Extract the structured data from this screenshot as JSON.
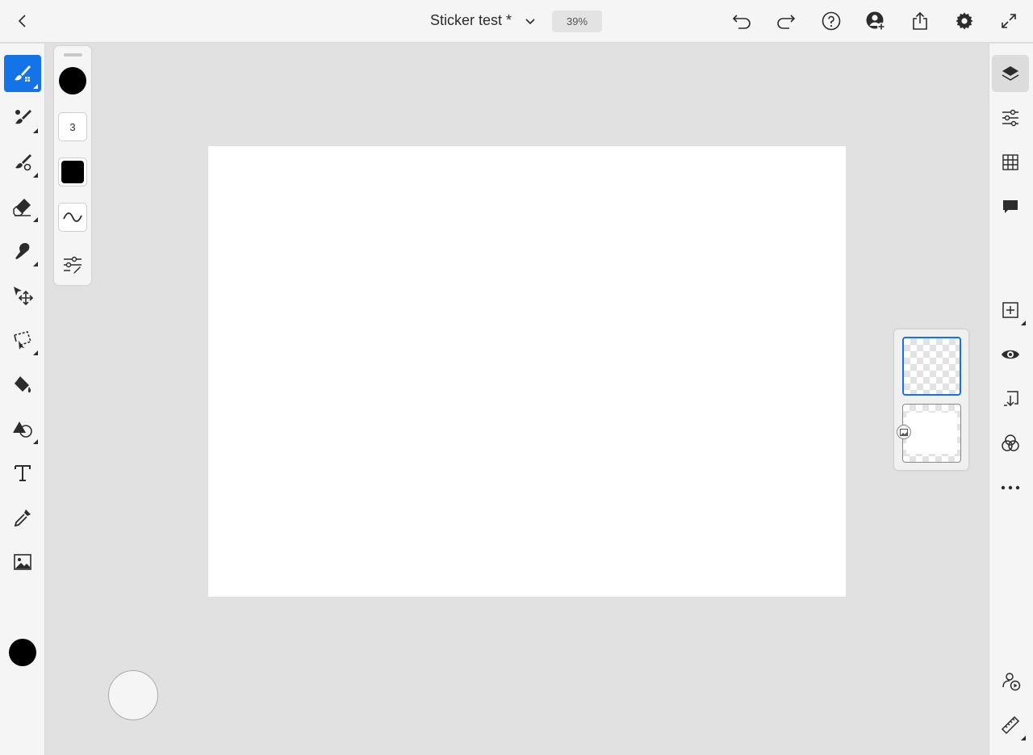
{
  "header": {
    "document_title": "Sticker test *",
    "zoom_level": "39%",
    "back_icon": "chevron-left-icon",
    "title_dropdown_icon": "chevron-down-icon",
    "actions": [
      "undo-icon",
      "redo-icon",
      "help-icon",
      "invite-icon",
      "share-icon",
      "settings-icon",
      "fullscreen-icon"
    ]
  },
  "tools": {
    "active_tool": "pixel-brush",
    "items": [
      "pixel-brush",
      "live-brush",
      "vector-brush",
      "eraser",
      "smudge",
      "transform",
      "selection",
      "fill",
      "shapes",
      "text",
      "eyedropper",
      "image"
    ],
    "current_color": "#000000",
    "accent_color": "#1473e6"
  },
  "brush_panel": {
    "color": "#000000",
    "size_value": "3",
    "flow_color": "#000000",
    "items": [
      "brush-color",
      "brush-size",
      "brush-flow",
      "brush-smoothing",
      "brush-settings"
    ]
  },
  "canvas": {
    "background": "#ffffff",
    "workspace_background": "#e1e1e1"
  },
  "layers": {
    "count": 2,
    "selected_index": 0,
    "second_layer_badge_icon": "image-icon"
  },
  "right_panel": {
    "active": "layers",
    "items": [
      "layers-icon",
      "layer-properties-icon",
      "grid-icon",
      "comments-icon",
      "add-layer-icon",
      "visibility-icon",
      "merge-down-icon",
      "blend-mode-icon",
      "more-icon",
      "livestream-icon",
      "ruler-icon"
    ]
  }
}
